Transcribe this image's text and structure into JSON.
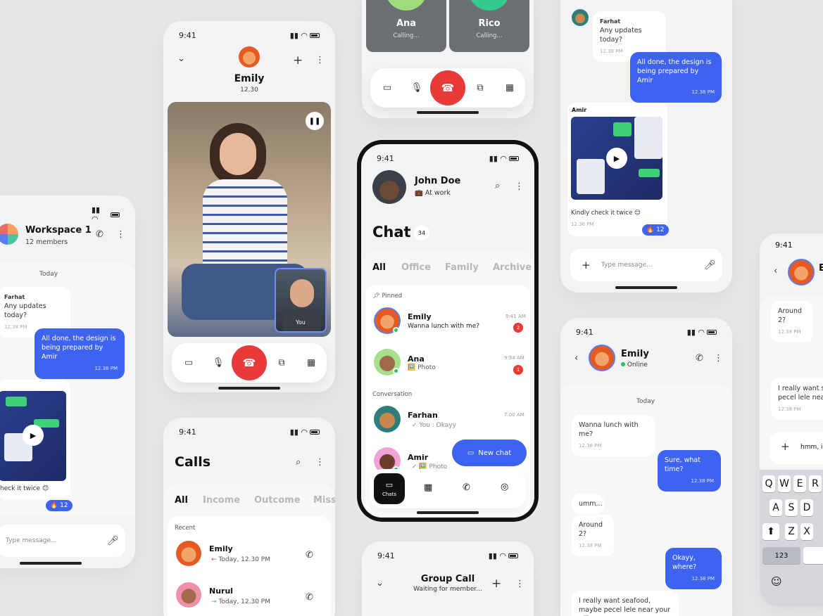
{
  "status_time": "9:41",
  "workspace": {
    "title": "Workspace 1",
    "members": "12 members",
    "day": "Today",
    "msg1_name": "Farhat",
    "msg1_text": "Any updates today?",
    "msg1_time": "12.38 PM",
    "msg2_text": "All done, the design is being prepared by Amir",
    "msg2_time": "12.38 PM",
    "media_caption": "heck it twice 😊",
    "reaction": "🔥 12",
    "input_placeholder": "Type message..."
  },
  "video_call": {
    "name": "Emily",
    "duration": "12.30",
    "pip_label": "You"
  },
  "calls": {
    "title": "Calls",
    "tabs": [
      "All",
      "Income",
      "Outcome",
      "Miss"
    ],
    "section": "Recent",
    "items": [
      {
        "name": "Emily",
        "sub": "Today, 12.30 PM",
        "arrow": "←"
      },
      {
        "name": "Nurul",
        "sub": "Today, 12.30 PM",
        "arrow": "→"
      }
    ]
  },
  "group_top": {
    "people": [
      {
        "name": "Ana",
        "status": "Calling..."
      },
      {
        "name": "Rico",
        "status": "Calling..."
      }
    ]
  },
  "main": {
    "user_name": "John Doe",
    "user_status": "💼 At work",
    "title": "Chat",
    "count": "34",
    "tabs": [
      "All",
      "Office",
      "Family",
      "Archive"
    ],
    "pinned_label": "Pinned",
    "conversation_label": "Conversation",
    "chats": [
      {
        "name": "Emily",
        "msg": "Wanna lunch with me?",
        "time": "9:41 AM",
        "badge": "2"
      },
      {
        "name": "Ana",
        "msg": "🖼️ Photo",
        "time": "9:34 AM",
        "badge": "1"
      },
      {
        "name": "Farhan",
        "msg": "✓ You : Okayy",
        "time": "7:00 AM"
      },
      {
        "name": "Amir",
        "msg": "✓ 🖼️ Photo",
        "time": ""
      }
    ],
    "new_chat": "New chat",
    "nav_chats": "Chats"
  },
  "group_call": {
    "title": "Group Call",
    "subtitle": "Waiting for member..."
  },
  "chat_top": {
    "farhat_name": "Farhat",
    "farhat_msg": "Any updates today?",
    "farhat_time": "12.38 PM",
    "out_msg": "All done, the design is being prepared by Amir",
    "out_time": "12.38 PM",
    "amir_name": "Amir",
    "caption": "Kindly check it twice 😊",
    "caption_time": "12.38 PM",
    "reaction": "🔥 12",
    "input_placeholder": "Type message..."
  },
  "emily_chat": {
    "name": "Emily",
    "status": "Online",
    "day": "Today",
    "messages": [
      {
        "dir": "in",
        "text": "Wanna lunch with me?",
        "time": "12.38 PM"
      },
      {
        "dir": "out",
        "text": "Sure, what time?",
        "time": "12.38 PM"
      },
      {
        "dir": "in",
        "text": "umm...",
        "time": ""
      },
      {
        "dir": "in",
        "text": "Around 2?",
        "time": "12.38 PM"
      },
      {
        "dir": "out",
        "text": "Okayy, where?",
        "time": "12.38 PM"
      },
      {
        "dir": "in",
        "text": "I really want seafood, maybe pecel lele near your office?",
        "time": ""
      }
    ]
  },
  "keyboard_chat": {
    "msg1": "Around 2?",
    "msg1_time": "12.38 PM",
    "msg2": "I really want se pecel lele near",
    "msg2_time": "12.38 PM",
    "input": "hmm, i",
    "row1": [
      "Q",
      "W",
      "E",
      "R"
    ],
    "row2": [
      "A",
      "S",
      "D"
    ],
    "row3": [
      "Z",
      "X"
    ],
    "numkey": "123"
  }
}
